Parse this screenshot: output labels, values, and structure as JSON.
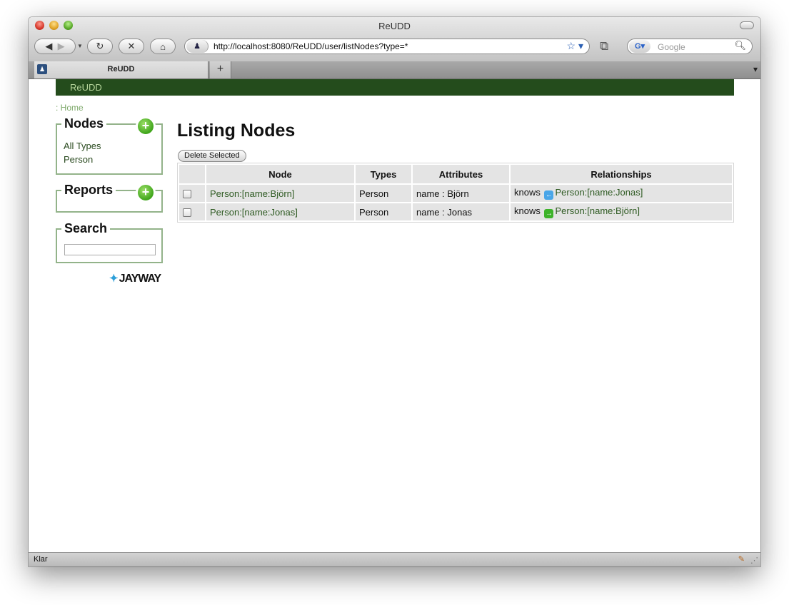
{
  "browser": {
    "window_title": "ReUDD",
    "url": "http://localhost:8080/ReUDD/user/listNodes?type=*",
    "search_placeholder": "Google",
    "tab_label": "ReUDD",
    "status_text": "Klar"
  },
  "site": {
    "brand": "ReUDD",
    "breadcrumb": ": Home"
  },
  "sidebar": {
    "nodes_title": "Nodes",
    "node_links": [
      "All Types",
      "Person"
    ],
    "reports_title": "Reports",
    "search_title": "Search",
    "logo_text": "JAYWAY"
  },
  "main": {
    "title": "Listing Nodes",
    "delete_label": "Delete Selected",
    "columns": [
      "Node",
      "Types",
      "Attributes",
      "Relationships"
    ],
    "rows": [
      {
        "node": "Person:[name:Björn]",
        "types": "Person",
        "attributes": "name : Björn",
        "rel_type": "knows",
        "rel_direction": "incoming",
        "rel_target": "Person:[name:Jonas]"
      },
      {
        "node": "Person:[name:Jonas]",
        "types": "Person",
        "attributes": "name : Jonas",
        "rel_type": "knows",
        "rel_direction": "outgoing",
        "rel_target": "Person:[name:Björn]"
      }
    ]
  },
  "colors": {
    "header_bg": "#244c1c",
    "link": "#2e5a22",
    "box_border": "#93b38a",
    "add_button": "#3fa51a"
  }
}
